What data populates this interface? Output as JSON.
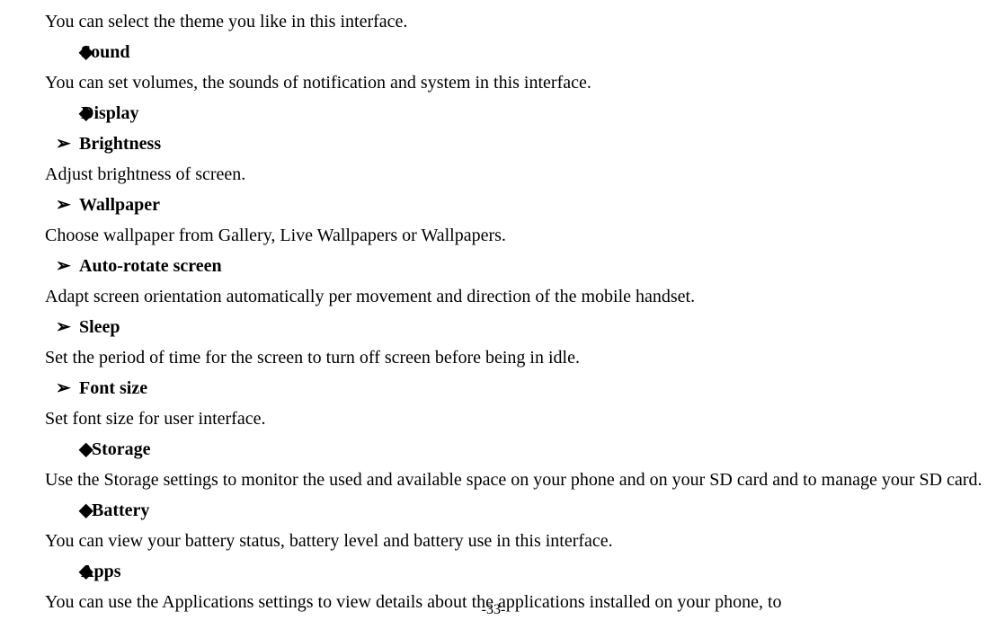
{
  "lines": {
    "theme_desc": "You can select the theme you like in this interface.",
    "sound_label": "Sound",
    "sound_desc": "You can set volumes, the sounds of notification and system in this interface.",
    "display_label": "Display",
    "brightness_label": "Brightness",
    "brightness_desc": "Adjust brightness of screen.",
    "wallpaper_label": "Wallpaper",
    "wallpaper_desc": "Choose wallpaper from Gallery, Live Wallpapers or Wallpapers.",
    "autorotate_label": "Auto-rotate screen",
    "autorotate_desc": "Adapt screen orientation automatically per movement and direction of the mobile handset.",
    "sleep_label": "Sleep",
    "sleep_desc": "Set the period of time for the screen to turn off screen before being in idle.",
    "fontsize_label": "Font size",
    "fontsize_desc": "Set font size for user interface.",
    "storage_label": "Storage",
    "storage_desc": "Use the Storage settings to monitor the used and available space on your phone and on your SD card and to manage your SD card.",
    "battery_label": "Battery",
    "battery_desc": "You can view your battery status, battery level and battery use in this interface.",
    "apps_label": "Apps",
    "apps_desc": "You can use the Applications settings to view details about the applications installed on your phone, to"
  },
  "bullets": {
    "diamond": "◆",
    "arrow": "➢"
  },
  "page_number": "-33-"
}
